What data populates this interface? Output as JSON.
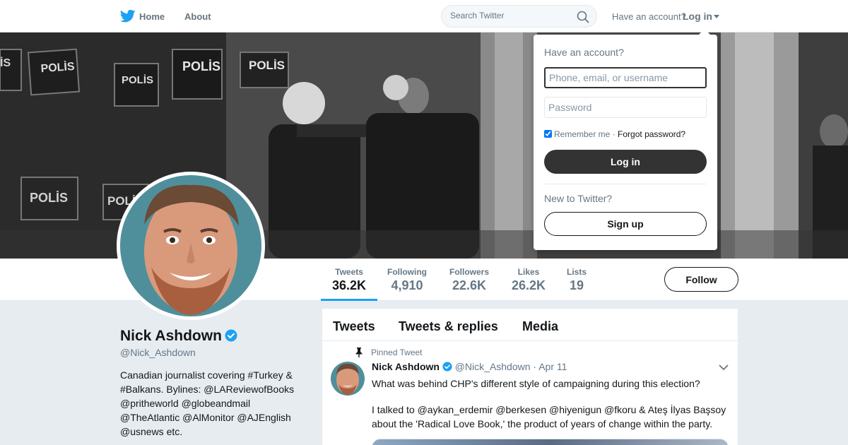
{
  "nav": {
    "home_label": "Home",
    "about_label": "About",
    "search_placeholder": "Search Twitter",
    "have_account_text": "Have an account?",
    "login_label": "Log in",
    "brand_color": "#1DA1F2"
  },
  "banner": {
    "sign_texts": [
      "POLİS",
      "POLİS",
      "POLİS",
      "POLİS",
      "POLİS",
      "POLİS",
      "İS"
    ]
  },
  "profile": {
    "name": "Nick Ashdown",
    "handle": "@Nick_Ashdown",
    "bio": "Canadian journalist covering #Turkey & #Balkans. Bylines: @LAReviewofBooks @pritheworld @globeandmail @TheAtlantic @AlMonitor @AJEnglish @usnews etc.",
    "verified": true
  },
  "stats": [
    {
      "label": "Tweets",
      "value": "36.2K",
      "active": true
    },
    {
      "label": "Following",
      "value": "4,910"
    },
    {
      "label": "Followers",
      "value": "22.6K"
    },
    {
      "label": "Likes",
      "value": "26.2K"
    },
    {
      "label": "Lists",
      "value": "19"
    }
  ],
  "follow_label": "Follow",
  "tabs": [
    "Tweets",
    "Tweets & replies",
    "Media"
  ],
  "pinned_tweet": {
    "pinned_label": "Pinned Tweet",
    "name": "Nick Ashdown",
    "handle": "@Nick_Ashdown",
    "separator": "·",
    "date": "Apr 11",
    "text_line1": "What was behind CHP's different style of campaigning during this election?",
    "text_line2": "I talked to @aykan_erdemir @berkesen @hiyenigun @fkoru & Ateş İlyas Başsoy about the 'Radical Love Book,' the product of years of change within the party."
  },
  "login_dropdown": {
    "title": "Have an account?",
    "username_placeholder": "Phone, email, or username",
    "password_placeholder": "Password",
    "remember_label": "Remember me",
    "separator": "·",
    "forgot_label": "Forgot password?",
    "login_button": "Log in",
    "new_text": "New to Twitter?",
    "signup_button": "Sign up",
    "remember_checked": true
  }
}
